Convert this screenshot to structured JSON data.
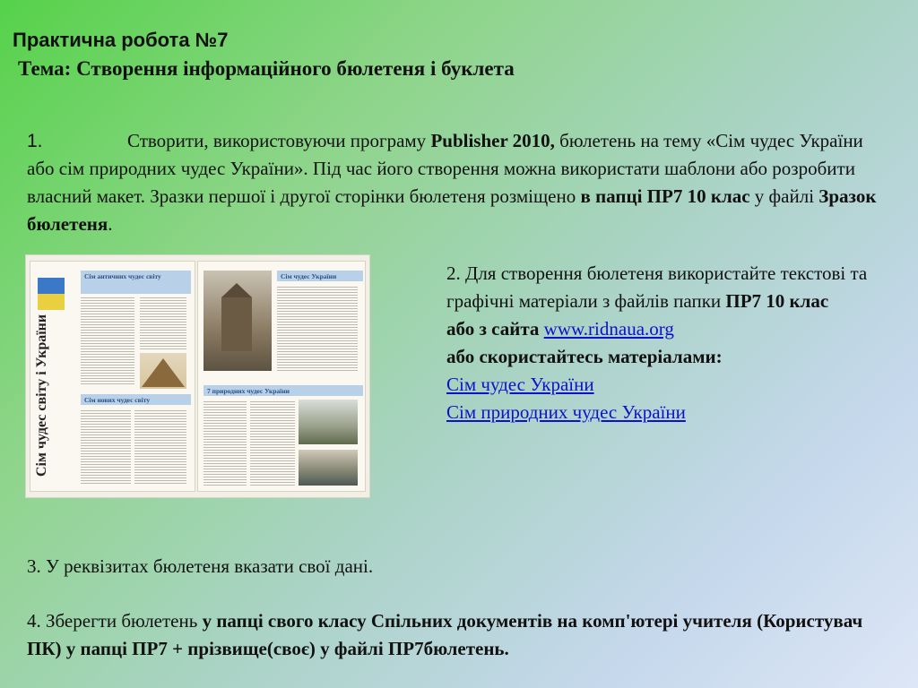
{
  "title": "Практична робота №7",
  "subtitle": "Тема: Створення інформаційного бюлетеня і буклета",
  "item1": {
    "number": "1.",
    "text_before": "Створити, використовуючи програму ",
    "bold1": "Publisher 2010,",
    "text_middle": " бюлетень на тему «Сім чудес України або сім природних чудес України». Під час його створення можна використати шаблони або розробити власний макет. Зразки першої і другої сторінки бюлетеня  розміщено ",
    "bold2": "в папці ПР7 10 клас",
    "text_after": " у файлі  ",
    "bold3": "Зразок бюлетеня",
    "end": "."
  },
  "item2": {
    "text": "2. Для створення бюлетеня використайте текстові  та графічні матеріали з файлів папки ",
    "bold1": "ПР7 10 клас",
    "bold2": "або з сайта ",
    "link_site": "www.ridnaua.org",
    "bold3": " або скористайтесь матеріалами:",
    "link1": "Сім чудес України",
    "link2": "Сім природних чудес України"
  },
  "item3": {
    "text": "3. У реквізитах бюлетеня вказати свої дані."
  },
  "item4": {
    "text": "4. Зберегти бюлетень ",
    "bold": "у папці свого класу Спільних документів на комп'ютері учителя (Користувач ПК)  у папці ПР7 + прізвище(своє) у файлі ПР7бюлетень."
  },
  "bulletin": {
    "spine_title": "Сім чудес світу і України",
    "left_header": "Сім античних чудес світу",
    "left_header2": "Сім нових чудес світу",
    "right_header": "Сім чудес України",
    "right_header2": "7 природних чудес України"
  },
  "colors": {
    "link": "#1010cc"
  }
}
